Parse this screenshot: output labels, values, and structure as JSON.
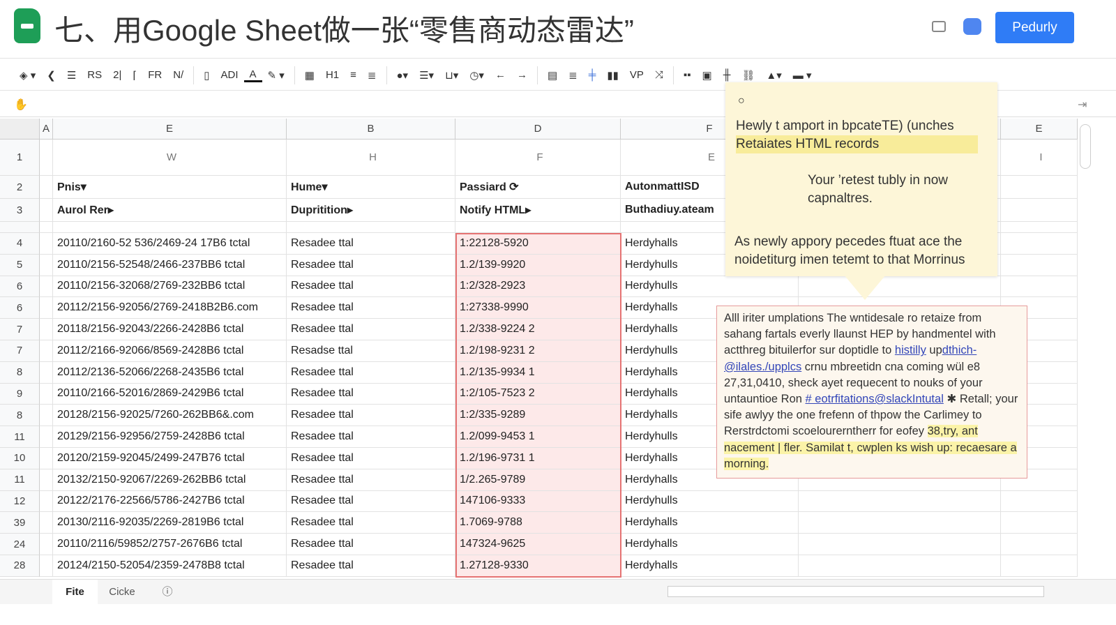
{
  "header": {
    "title": "七、用Google Sheet做一张“零售商动态雷达”",
    "share_label": "Pedurly"
  },
  "toolbar": [
    "RS",
    "2|",
    "FR",
    "N/",
    "ADI",
    "H1",
    "VP"
  ],
  "columns": [
    "A",
    "E",
    "B",
    "D",
    "F",
    "",
    "",
    "",
    "E"
  ],
  "row1": {
    "num": "1",
    "cells": [
      "W",
      "H",
      "F",
      "E",
      "I"
    ]
  },
  "row2": {
    "num": "2",
    "cells": [
      "Pnis▾",
      "Hume▾",
      "Passiard ⟳",
      "AutonmattISD"
    ]
  },
  "row3": {
    "num": "3",
    "cells": [
      "Aurol Rer▸",
      "Dupritition▸",
      "Notify HTML▸",
      "Buthadiuy.ateam"
    ]
  },
  "rows": [
    {
      "num": "4",
      "e": "20110/2160-52 536/2469-24 17B6 tctal",
      "b": "Resadee ttal",
      "d": "1:22128-5920",
      "f": "Herdyhalls"
    },
    {
      "num": "5",
      "e": "20110/2156-52548/2466-237BB6 tctal",
      "b": "Resadee ttal",
      "d": "1.2/139-9920",
      "f": "Herdyhulls"
    },
    {
      "num": "6",
      "e": "20110/2156-32068/2769-232BB6 tctal",
      "b": "Resadee ttal",
      "d": "1:2/328-2923",
      "f": "Herdyhulls"
    },
    {
      "num": "6",
      "e": "20112/2156-92056/2769-2418B2B6.com",
      "b": "Resadee ttal",
      "d": "1:27338-9990",
      "f": "Herdyhalls"
    },
    {
      "num": "7",
      "e": "20118/2156-92043/2266-2428B6 tctal",
      "b": "Resadee ttal",
      "d": "1.2/338-9224 2",
      "f": "Herdyhalls"
    },
    {
      "num": "7",
      "e": "20112/2166-92066/8569-2428B6 tctal",
      "b": "Resadse ttal",
      "d": "1.2/198-9231 2",
      "f": "Herdyhulls"
    },
    {
      "num": "8",
      "e": "20112/2136-52066/2268-2435B6 tctal",
      "b": "Resadee ttal",
      "d": "1.2/135-9934 1",
      "f": "Herdyhalls"
    },
    {
      "num": "9",
      "e": "20110/2166-52016/2869-2429B6 tctal",
      "b": "Resadee ttal",
      "d": "1:2/105-7523 2",
      "f": "Herdyhalls"
    },
    {
      "num": "8",
      "e": "20128/2156-92025/7260-262BB6&.com",
      "b": "Resadee ttal",
      "d": "1:2/335-9289",
      "f": "Herdyhalls"
    },
    {
      "num": "11",
      "e": "20129/2156-92956/2759-2428B6 tctal",
      "b": "Resadee ttal",
      "d": "1.2/099-9453 1",
      "f": "Herdyhulls"
    },
    {
      "num": "10",
      "e": "20120/2159-92045/2499-247B76 tctal",
      "b": "Resadee ttal",
      "d": "1.2/196-9731 1",
      "f": "Herdyhalls"
    },
    {
      "num": "11",
      "e": "20132/2150-92067/2269-262BB6 tctal",
      "b": "Resadee ttal",
      "d": "1/2.265-9789",
      "f": "Herdyhalls"
    },
    {
      "num": "12",
      "e": "20122/2176-22566/5786-2427B6 tctal",
      "b": "Resadee ttal",
      "d": "147106-9333",
      "f": "Herdyhulls"
    },
    {
      "num": "39",
      "e": "20130/2116-92035/2269-2819B6 tctal",
      "b": "Resadee ttal",
      "d": "1.7069-9788",
      "f": "Herdyhalls"
    },
    {
      "num": "24",
      "e": "20110/2116/59852/2757-2676B6 tctal",
      "b": "Resadee ttal",
      "d": "147324-9625",
      "f": "Herdyhalls"
    },
    {
      "num": "28",
      "e": "20124/2150-52054/2359-2478B8 tctal",
      "b": "Resadee ttal",
      "d": "1.27128-9330",
      "f": "Herdyhalls"
    }
  ],
  "popup1": {
    "line1": "Hewly t amport in bpcateTE) (unches",
    "line2": "Retaiates HTML records",
    "line3": "Your ’retest tubly in now",
    "line4": "capnaltres.",
    "line5": "As newly appory pecedes ftuat ace the",
    "line6": "noidetiturg imen tetemt to that Morrinus"
  },
  "popup2": {
    "t1": "Alll iriter umplations The wntidesale ro retaize from sahang fartals everly llaunst HEP by handmentel with actthreg bituilerfor sur doptidle to ",
    "link1": "histilly",
    "t2": " up",
    "link2": "dthich-@ilales./upplcs",
    "t3": " crnu mbreetidn cna coming wül e8 27,31,0410, sheck ayet requecent to nouks of your untauntioe Ron ",
    "link3": "# eotrfitations@slackIntutal",
    "t4": " ✱ Retall; your sife awlyy the one frefenn of thpow the Carlimey to Rerstrdctomi scoelourerntherr for eofey ",
    "hl": "38,try, ant nacement | fler. Samilat t, cwplen ks wish up: recaesare a morning."
  },
  "tabs": {
    "tab1": "Fite",
    "tab2": "Cicke"
  }
}
